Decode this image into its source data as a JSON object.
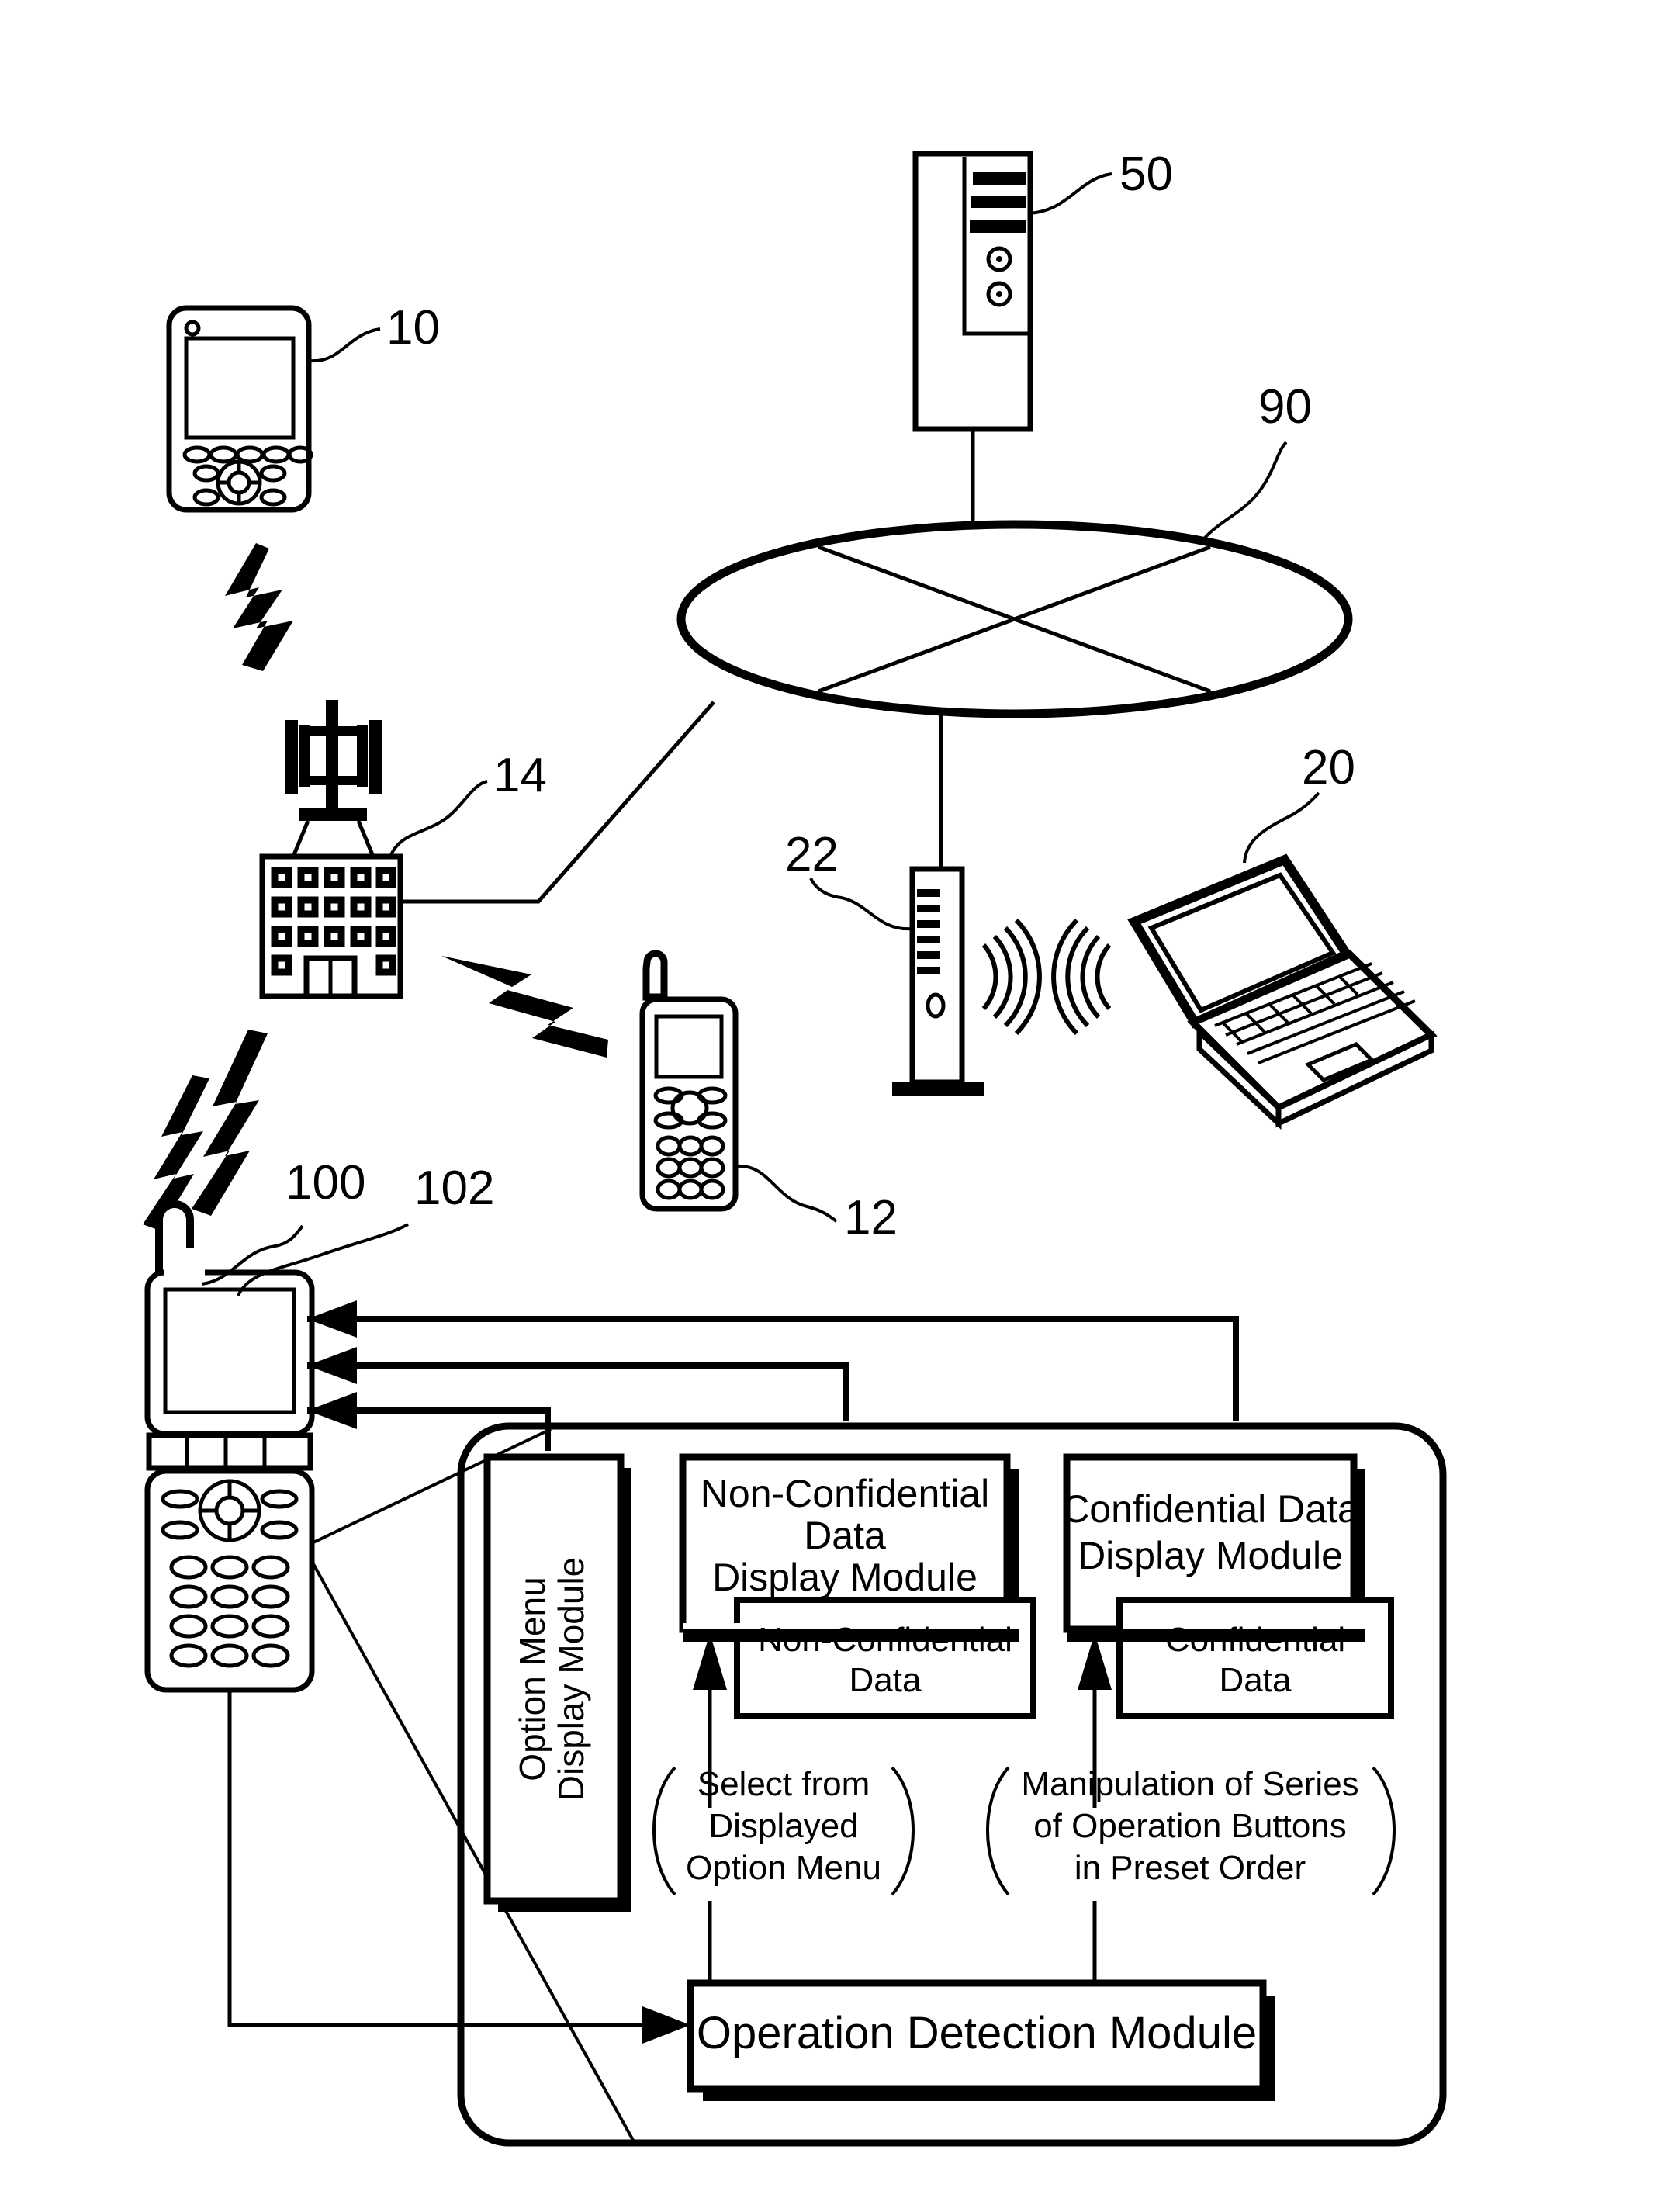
{
  "figure": {
    "type": "patent-system-diagram",
    "description": "Mobile communication system block diagram with confidential data display modules"
  },
  "reference_labels": [
    {
      "id": "r10",
      "text": "10",
      "target": "pda-device"
    },
    {
      "id": "r50",
      "text": "50",
      "target": "server-device"
    },
    {
      "id": "r90",
      "text": "90",
      "target": "network-cloud"
    },
    {
      "id": "r14",
      "text": "14",
      "target": "base-station-building"
    },
    {
      "id": "r20",
      "text": "20",
      "target": "laptop-computer"
    },
    {
      "id": "r22",
      "text": "22",
      "target": "wireless-access-point"
    },
    {
      "id": "r12",
      "text": "12",
      "target": "mobile-phone"
    },
    {
      "id": "r100",
      "text": "100",
      "target": "flip-phone-terminal"
    },
    {
      "id": "r102",
      "text": "102",
      "target": "flip-phone-display"
    }
  ],
  "modules": {
    "option_menu": {
      "label_line1": "Option Menu",
      "label_line2": "Display Module"
    },
    "non_confidential_display": {
      "label_line1": "Non-Confidential",
      "label_line2": "Data",
      "label_line3": "Display Module"
    },
    "confidential_display": {
      "label_line1": "Confidential Data",
      "label_line2": "Display Module"
    },
    "non_confidential_data": {
      "label_line1": "Non-Confidential",
      "label_line2": "Data"
    },
    "confidential_data": {
      "label_line1": "Confidential",
      "label_line2": "Data"
    },
    "operation_detection": {
      "label": "Operation Detection Module"
    }
  },
  "annotations": {
    "select_option_menu": {
      "line1": "Select from",
      "line2": "Displayed",
      "line3": "Option Menu",
      "open_paren": "(",
      "close_paren": ")"
    },
    "manipulation_buttons": {
      "line1": "Manipulation of Series",
      "line2": "of Operation Buttons",
      "line3": "in Preset Order",
      "open_paren": "(",
      "close_paren": ")"
    }
  },
  "devices": {
    "pda": {
      "name": "PDA handheld terminal"
    },
    "server": {
      "name": "Server / communication unit"
    },
    "network": {
      "name": "Network cloud"
    },
    "base_station": {
      "name": "Base station building with antenna"
    },
    "laptop": {
      "name": "Laptop computer"
    },
    "access_point": {
      "name": "Wireless access point"
    },
    "mobile_phone": {
      "name": "Mobile phone handset"
    },
    "flip_phone": {
      "name": "Flip phone communication terminal"
    }
  },
  "colors": {
    "line": "#000000",
    "background": "#ffffff",
    "fill": "#ffffff"
  }
}
